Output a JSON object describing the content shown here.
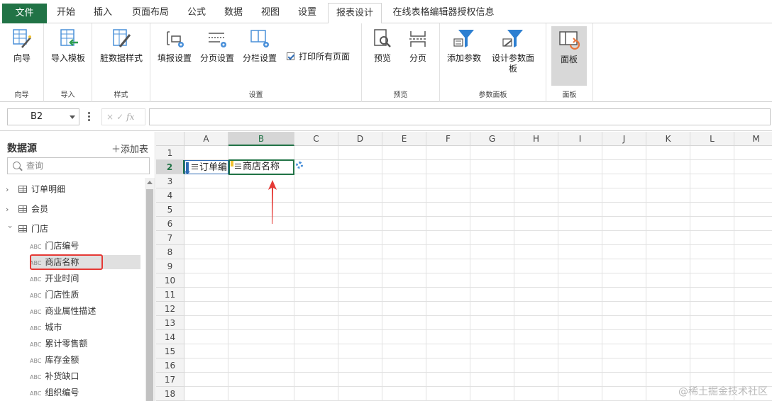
{
  "tabs": [
    {
      "label": "文件",
      "kind": "file"
    },
    {
      "label": "开始"
    },
    {
      "label": "插入"
    },
    {
      "label": "页面布局"
    },
    {
      "label": "公式"
    },
    {
      "label": "数据"
    },
    {
      "label": "视图"
    },
    {
      "label": "设置"
    },
    {
      "label": "报表设计",
      "active": true
    },
    {
      "label": "在线表格编辑器授权信息"
    }
  ],
  "ribbon": {
    "groups": {
      "wizard": "向导",
      "import": "导入",
      "style": "样式",
      "settings": "设置",
      "preview": "预览",
      "param_panel": "参数面板",
      "panel": "面板"
    },
    "buttons": {
      "wizard": "向导",
      "import_template": "导入模板",
      "dirty_data_style": "脏数据样式",
      "fill_settings": "填报设置",
      "page_settings": "分页设置",
      "column_settings": "分栏设置",
      "print_all_pages": "打印所有页面",
      "preview": "预览",
      "paging": "分页",
      "add_param": "添加参数",
      "design_param_panel": "设计参数面板",
      "panel": "面板"
    },
    "print_all_checked": true
  },
  "formula_bar": {
    "cell_ref": "B2",
    "cancel": "×",
    "confirm": "✓",
    "fx": "fx",
    "value": ""
  },
  "datasource": {
    "title": "数据源",
    "add_table": "添加表",
    "search_placeholder": "查询",
    "tables": [
      {
        "name": "订单明细",
        "expanded": false
      },
      {
        "name": "会员",
        "expanded": false
      },
      {
        "name": "门店",
        "expanded": true
      }
    ],
    "field_type": "ABC",
    "fields": [
      "门店编号",
      "商店名称",
      "开业时间",
      "门店性质",
      "商业属性描述",
      "城市",
      "累计零售额",
      "库存金额",
      "补货缺口",
      "组织编号"
    ],
    "selected_field": "商店名称"
  },
  "sheet": {
    "columns": [
      "A",
      "B",
      "C",
      "D",
      "E",
      "F",
      "G",
      "H",
      "I",
      "J",
      "K",
      "L",
      "M"
    ],
    "rows": [
      "1",
      "2",
      "3",
      "4",
      "5",
      "6",
      "7",
      "8",
      "9",
      "10",
      "11",
      "12",
      "13",
      "14",
      "15",
      "16",
      "17",
      "18"
    ],
    "active_column": "B",
    "active_row": "2",
    "cells": {
      "A2": "订单编",
      "B2": "商店名称"
    }
  },
  "watermark": "@稀土掘金技术社区",
  "colors": {
    "file_tab": "#217346",
    "accent_blue": "#2d6ab4",
    "highlight_red": "#e53935"
  }
}
